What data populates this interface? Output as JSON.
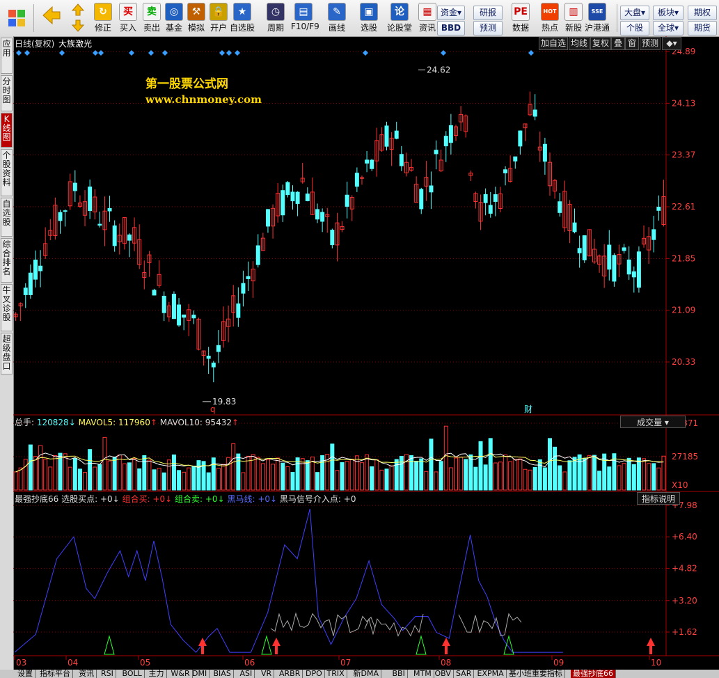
{
  "toolbar": {
    "main_buttons": [
      {
        "label": "修正",
        "icon": "refresh-icon"
      },
      {
        "label": "买入",
        "icon": "buy-icon"
      },
      {
        "label": "卖出",
        "icon": "sell-icon"
      },
      {
        "label": "基金",
        "icon": "fund-icon"
      },
      {
        "label": "模拟",
        "icon": "hammer-icon"
      },
      {
        "label": "开户",
        "icon": "lock-icon"
      },
      {
        "label": "自选股",
        "icon": "star-icon"
      },
      {
        "label": "周期",
        "icon": "clock-icon"
      },
      {
        "label": "F10/F9",
        "icon": "f10-icon"
      },
      {
        "label": "画线",
        "icon": "pen-icon"
      },
      {
        "label": "选股",
        "icon": "screen-icon"
      },
      {
        "label": "论股堂",
        "icon": "forum-icon"
      },
      {
        "label": "资讯",
        "icon": "news-icon"
      },
      {
        "label": "数据",
        "icon": "pe-icon"
      },
      {
        "label": "热点",
        "icon": "hot-icon"
      },
      {
        "label": "新股",
        "icon": "newstock-icon"
      },
      {
        "label": "沪港通",
        "icon": "sse-hke-icon"
      }
    ],
    "small_buttons": {
      "zijin": "资金",
      "bbd": "BBD",
      "yanbao": "研报",
      "yuce": "预测",
      "dapan": "大盘",
      "bankuai": "板块",
      "qihuo": "期权",
      "gegu": "个股",
      "quanqiu": "全球",
      "qihuo2": "期货"
    }
  },
  "left_tabs": [
    "应用",
    "分时图",
    "K线图",
    "个股资料",
    "自选股",
    "综合排名",
    "牛叉诊股",
    "超级盘口"
  ],
  "chart": {
    "header_left": "日线(复权)",
    "stock_name": "大族激光",
    "header_buttons": [
      "加自选",
      "均线",
      "复权",
      "叠",
      "窗",
      "预测"
    ],
    "watermark_title": "第一股票公式网",
    "watermark_url": "www.chnmoney.com",
    "price_axis": [
      "24.89",
      "24.13",
      "23.37",
      "22.61",
      "21.85",
      "21.09",
      "20.33"
    ],
    "high_label": "24.62",
    "low_label": "19.83",
    "marker_q": "q",
    "marker_cai": "财",
    "volume_info": {
      "zongshou_label": "总手:",
      "zongshou_value": "120828",
      "mavol5_label": "MAVOL5:",
      "mavol5_value": "117960",
      "mavol10_label": "MAVOL10:",
      "mavol10_value": "95432",
      "dropdown": "成交量",
      "axis": [
        "54371",
        "27185"
      ],
      "unit": "X10"
    },
    "indicator": {
      "name": "最强抄底66",
      "item1": "选股买点: +0",
      "item2": "组合买: +0",
      "item3": "组合卖: +0",
      "item4": "黑马线: +0",
      "item5": "黑马信号介入点: +0",
      "button": "指标说明",
      "axis": [
        "7.98",
        "6.40",
        "4.82",
        "3.20",
        "1.62"
      ]
    },
    "months": [
      "03",
      "04",
      "05",
      "06",
      "07",
      "08",
      "09",
      "10"
    ],
    "colors": {
      "up": "#ff3232",
      "down": "#54ffff",
      "grid": "#8b0000",
      "axis_text": "#ff4040",
      "wave": "#4040ff"
    }
  },
  "bottom_tabs": [
    "设置",
    "指标平台",
    "资讯",
    "RSI",
    "BOLL",
    "主力",
    "W&R",
    "DMI",
    "BIAS",
    "ASI",
    "VR",
    "ARBR",
    "DPO",
    "TRIX",
    "新DMA",
    "BBI",
    "MTM",
    "OBV",
    "SAR",
    "EXPMA",
    "基小班重要指标",
    "最强抄底66"
  ],
  "active_bottom_tab": "最强抄底66"
}
